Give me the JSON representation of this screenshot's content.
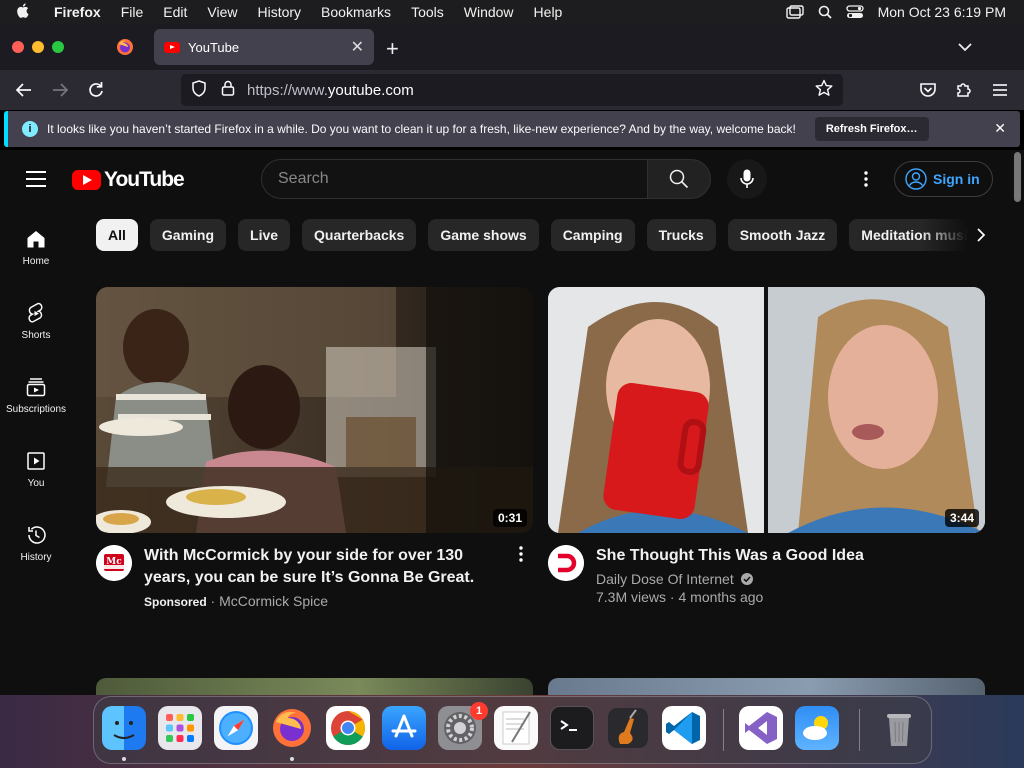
{
  "menubar": {
    "app": "Firefox",
    "items": [
      "File",
      "Edit",
      "View",
      "History",
      "Bookmarks",
      "Tools",
      "Window",
      "Help"
    ],
    "clock": "Mon Oct 23  6:19 PM"
  },
  "browser": {
    "tab_title": "YouTube",
    "url_proto": "https://www.",
    "url_host": "youtube.com",
    "notification": "It looks like you haven’t started Firefox in a while. Do you want to clean it up for a fresh, like-new experience? And by the way, welcome back!",
    "refresh_label": "Refresh Firefox…"
  },
  "youtube": {
    "logo_text": "YouTube",
    "search_placeholder": "Search",
    "signin_label": "Sign in",
    "chips": [
      "All",
      "Gaming",
      "Live",
      "Quarterbacks",
      "Game shows",
      "Camping",
      "Trucks",
      "Smooth Jazz",
      "Meditation music"
    ],
    "sidebar": [
      "Home",
      "Shorts",
      "Subscriptions",
      "You",
      "History"
    ],
    "videos": [
      {
        "title": "With McCormick by your side for over 130 years, you can be sure It’s Gonna Be Great.",
        "sponsored": "Sponsored",
        "channel": "McCormick Spice",
        "duration": "0:31"
      },
      {
        "title": "She Thought This Was a Good Idea",
        "channel": "Daily Dose Of Internet",
        "views": "7.3M views",
        "age": "4 months ago",
        "duration": "3:44"
      }
    ]
  },
  "dock": {
    "settings_badge": "1"
  },
  "colors": {
    "yt_red": "#ff0000",
    "link_blue": "#3ea6ff",
    "page_bg": "#0f0f0f",
    "chip_bg": "#272727"
  }
}
